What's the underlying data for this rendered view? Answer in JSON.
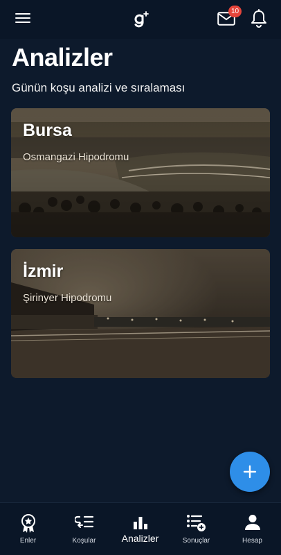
{
  "header": {
    "notification_count": "10"
  },
  "main": {
    "title": "Analizler",
    "subtitle": "Günün koşu analizi ve sıralaması",
    "cards": [
      {
        "city": "Bursa",
        "venue": "Osmangazi Hipodromu"
      },
      {
        "city": "İzmir",
        "venue": "Şirinyer Hipodromu"
      }
    ]
  },
  "bottom_nav": {
    "items": [
      {
        "label": "Enler",
        "icon": "award-icon",
        "active": false
      },
      {
        "label": "Koşular",
        "icon": "race-list-icon",
        "active": false
      },
      {
        "label": "Analizler",
        "icon": "bar-chart-icon",
        "active": true
      },
      {
        "label": "Sonuçlar",
        "icon": "results-list-icon",
        "active": false
      },
      {
        "label": "Hesap",
        "icon": "user-icon",
        "active": false
      }
    ]
  },
  "colors": {
    "background": "#0d1a2c",
    "bar": "#0a1627",
    "accent": "#2e8ee8",
    "badge": "#e5453b"
  }
}
